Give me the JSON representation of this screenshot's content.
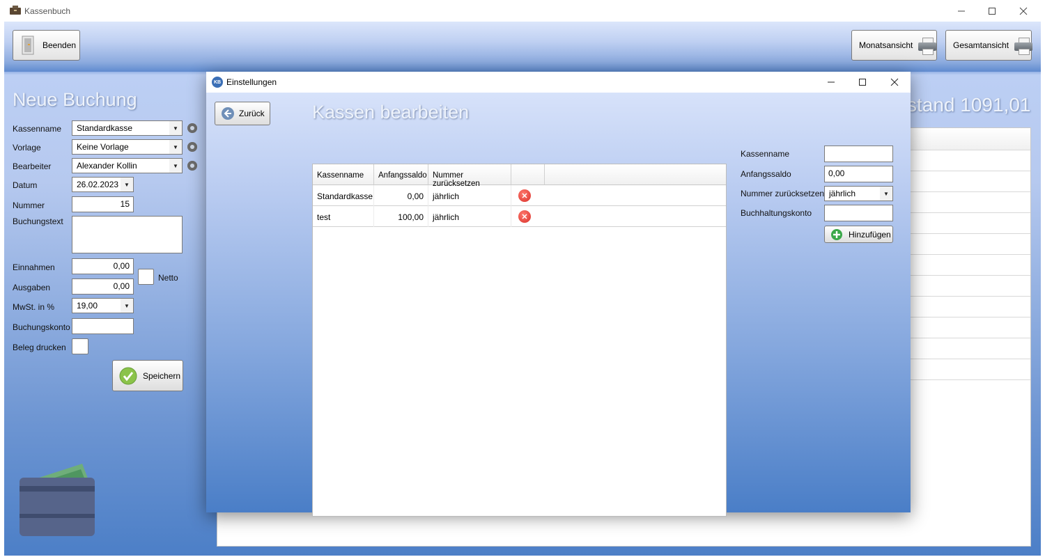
{
  "main_window": {
    "title": "Kassenbuch",
    "toolbar": {
      "quit_label": "Beenden",
      "month_view_label": "Monatsansicht",
      "total_view_label": "Gesamtansicht"
    },
    "balance_text": "stand 1091,01",
    "new_booking": {
      "title": "Neue Buchung",
      "labels": {
        "kassenname": "Kassenname",
        "vorlage": "Vorlage",
        "bearbeiter": "Bearbeiter",
        "datum": "Datum",
        "nummer": "Nummer",
        "buchungstext": "Buchungstext",
        "einnahmen": "Einnahmen",
        "ausgaben": "Ausgaben",
        "mwst": "MwSt. in %",
        "buchungskonto": "Buchungskonto",
        "beleg_drucken": "Beleg drucken",
        "netto": "Netto"
      },
      "values": {
        "kassenname": "Standardkasse",
        "vorlage": "Keine Vorlage",
        "bearbeiter": "Alexander Kollin",
        "datum": "26.02.2023",
        "nummer": "15",
        "buchungstext": "",
        "einnahmen": "0,00",
        "ausgaben": "0,00",
        "mwst": "19,00",
        "buchungskonto": ""
      },
      "save_label": "Speichern"
    }
  },
  "dialog": {
    "title": "Einstellungen",
    "back_label": "Zurück",
    "heading": "Kassen bearbeiten",
    "table": {
      "headers": [
        "Kassenname",
        "Anfangssaldo",
        "Nummer zurücksetzen",
        ""
      ],
      "rows": [
        {
          "kassenname": "Standardkasse",
          "anfangssaldo": "0,00",
          "nummer": "jährlich"
        },
        {
          "kassenname": "test",
          "anfangssaldo": "100,00",
          "nummer": "jährlich"
        }
      ]
    },
    "form": {
      "labels": {
        "kassenname": "Kassenname",
        "anfangssaldo": "Anfangssaldo",
        "nummer_zuruecksetzen": "Nummer zurücksetzen",
        "buchhaltungskonto": "Buchhaltungskonto"
      },
      "values": {
        "kassenname": "",
        "anfangssaldo": "0,00",
        "nummer_zuruecksetzen": "jährlich",
        "buchhaltungskonto": ""
      },
      "add_label": "Hinzufügen"
    }
  },
  "icons": {
    "app": "cash-box-icon",
    "quit": "door-icon",
    "print": "printer-icon",
    "gear": "gear-icon",
    "back": "arrow-left-icon",
    "delete": "delete-icon",
    "add": "plus-icon",
    "save": "checkmark-icon",
    "wallet": "wallet-icon"
  },
  "colors": {
    "accent_blue": "#4a7ec7",
    "delete_red": "#d9302a",
    "add_green": "#3aa84a",
    "save_green": "#7cb342"
  }
}
